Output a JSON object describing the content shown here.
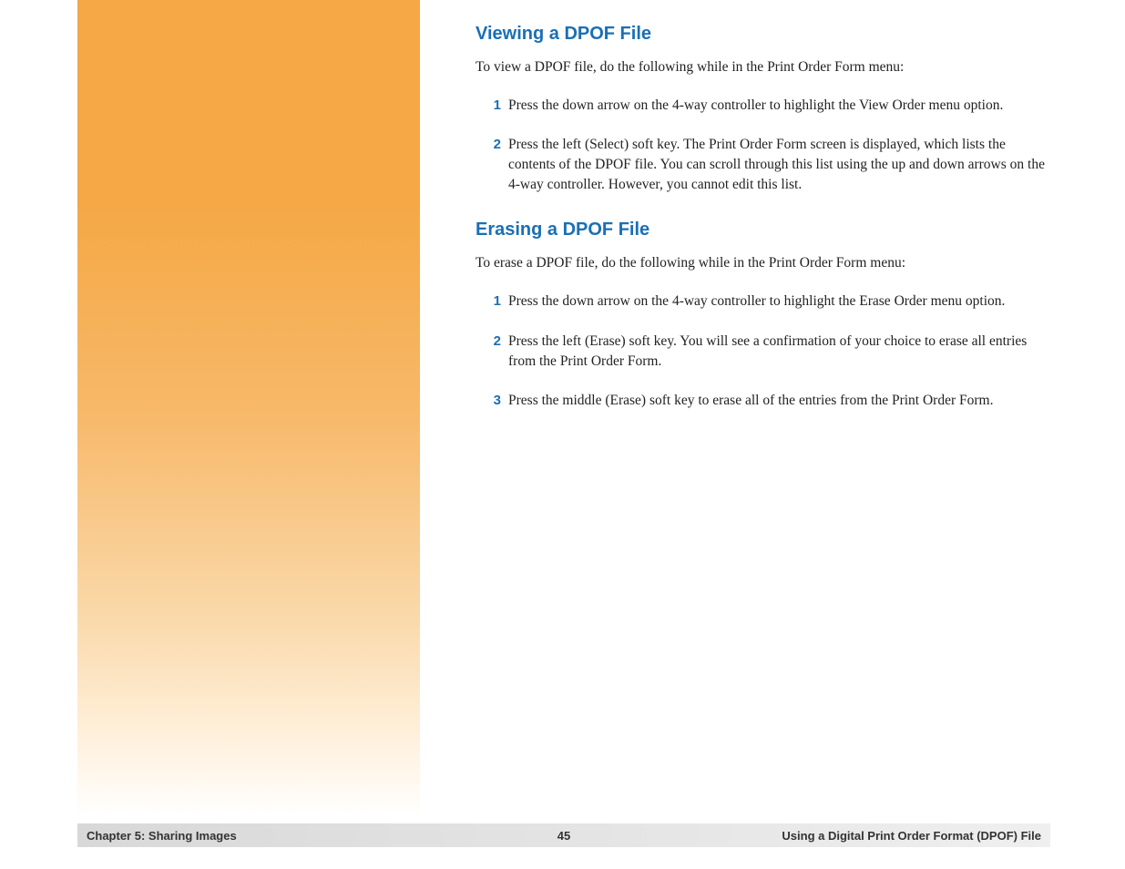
{
  "section1": {
    "heading": "Viewing a DPOF File",
    "intro": "To view a DPOF file, do the following while in the Print Order Form menu:",
    "steps": [
      {
        "num": "1",
        "text": "Press the down arrow on the 4-way controller to highlight the View Order menu option."
      },
      {
        "num": "2",
        "text": "Press the left (Select) soft key. The Print Order Form screen is displayed, which lists the contents of the DPOF file. You can scroll through this list using the up and down arrows on the 4-way controller. However, you cannot edit this list."
      }
    ]
  },
  "section2": {
    "heading": "Erasing a DPOF File",
    "intro": "To erase a DPOF file, do the following while in the Print Order Form menu:",
    "steps": [
      {
        "num": "1",
        "text": "Press the down arrow on the 4-way controller to highlight the Erase Order menu option."
      },
      {
        "num": "2",
        "text": "Press the left (Erase) soft key. You will see a confirmation of your choice to erase all entries from the Print Order Form."
      },
      {
        "num": "3",
        "text": "Press the middle (Erase) soft key to erase all of the entries from the Print Order Form."
      }
    ]
  },
  "footer": {
    "left": "Chapter 5: Sharing Images",
    "center": "45",
    "right": "Using a Digital Print Order Format (DPOF) File"
  }
}
